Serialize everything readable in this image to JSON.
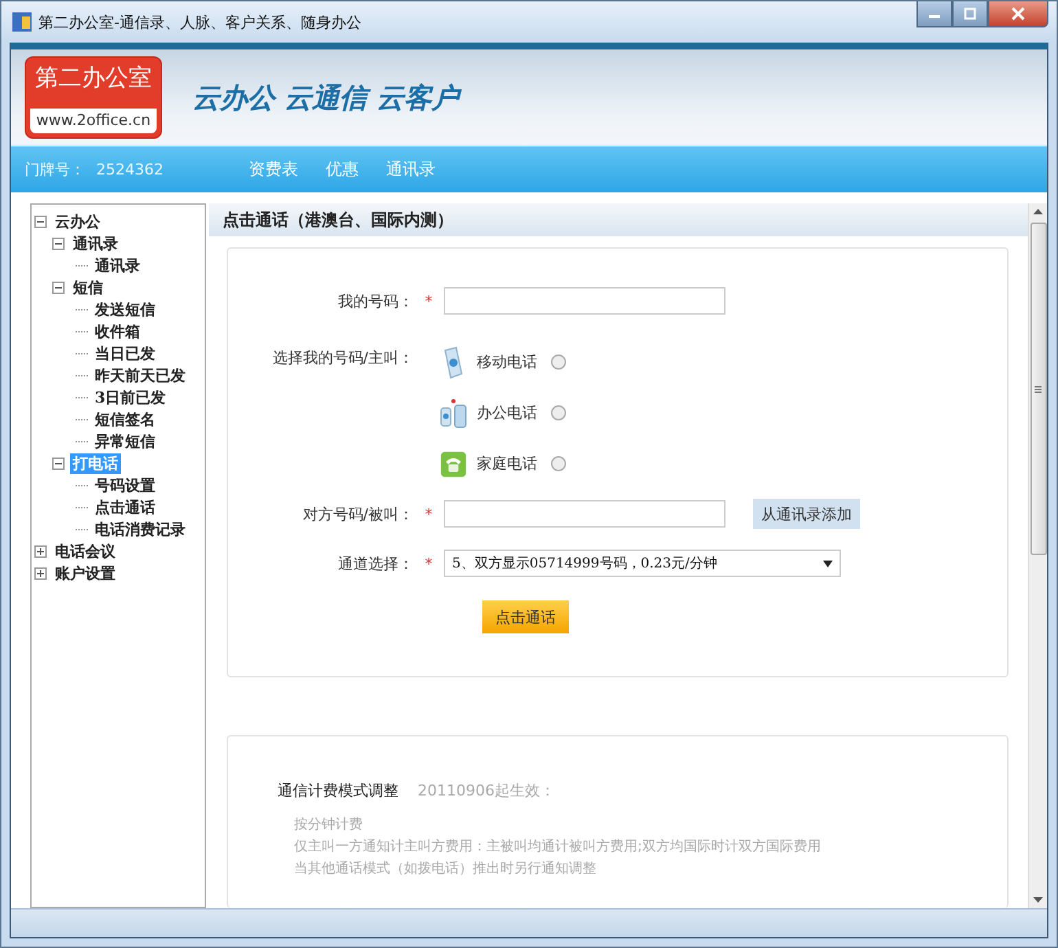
{
  "window": {
    "title": "第二办公室-通信录、人脉、客户关系、随身办公"
  },
  "header": {
    "logo_title": "第二办公室",
    "logo_url": "www.2office.cn",
    "slogan": "云办公 云通信 云客户"
  },
  "nav": {
    "account_label": "门牌号：",
    "account_number": "2524362",
    "links": [
      "资费表",
      "优惠",
      "通讯录"
    ]
  },
  "sidebar": {
    "tree": [
      {
        "label": "云办公",
        "expanded": true,
        "selected": false,
        "children": [
          {
            "label": "通讯录",
            "expanded": true,
            "selected": false,
            "children": [
              {
                "label": "通讯录",
                "selected": false
              }
            ]
          },
          {
            "label": "短信",
            "expanded": true,
            "selected": false,
            "children": [
              {
                "label": "发送短信",
                "selected": false
              },
              {
                "label": "收件箱",
                "selected": false
              },
              {
                "label": "当日已发",
                "selected": false
              },
              {
                "label": "昨天前天已发",
                "selected": false
              },
              {
                "label": "3日前已发",
                "selected": false
              },
              {
                "label": "短信签名",
                "selected": false
              },
              {
                "label": "异常短信",
                "selected": false
              }
            ]
          },
          {
            "label": "打电话",
            "expanded": true,
            "selected": true,
            "children": [
              {
                "label": "号码设置",
                "selected": false
              },
              {
                "label": "点击通话",
                "selected": false
              },
              {
                "label": "电话消费记录",
                "selected": false
              }
            ]
          }
        ]
      },
      {
        "label": "电话会议",
        "expanded": false,
        "selected": false
      },
      {
        "label": "账户设置",
        "expanded": false,
        "selected": false
      }
    ]
  },
  "panel": {
    "title": "点击通话（港澳台、国际内测）",
    "my_number": {
      "label": "我的号码：",
      "required_mark": "*"
    },
    "caller": {
      "label": "选择我的号码/主叫：",
      "options": [
        {
          "kind": "mobile",
          "label": "移动电话",
          "selected": false
        },
        {
          "kind": "office",
          "label": "办公电话",
          "selected": false
        },
        {
          "kind": "home",
          "label": "家庭电话",
          "selected": false
        }
      ]
    },
    "callee": {
      "label": "对方号码/被叫：",
      "required_mark": "*",
      "button": "从通讯录添加"
    },
    "channel": {
      "label": "通道选择：",
      "required_mark": "*",
      "value": "5、双方显示05714999号码，0.23元/分钟"
    },
    "submit": "点击通话"
  },
  "notice": {
    "title": "通信计费模式调整",
    "date": "20110906起生效：",
    "lines": [
      "按分钟计费",
      "仅主叫一方通知计主叫方费用：主被叫均通计被叫方费用;双方均国际时计双方国际费用",
      "当其他通话模式（如拨电话）推出时另行通知调整"
    ]
  }
}
